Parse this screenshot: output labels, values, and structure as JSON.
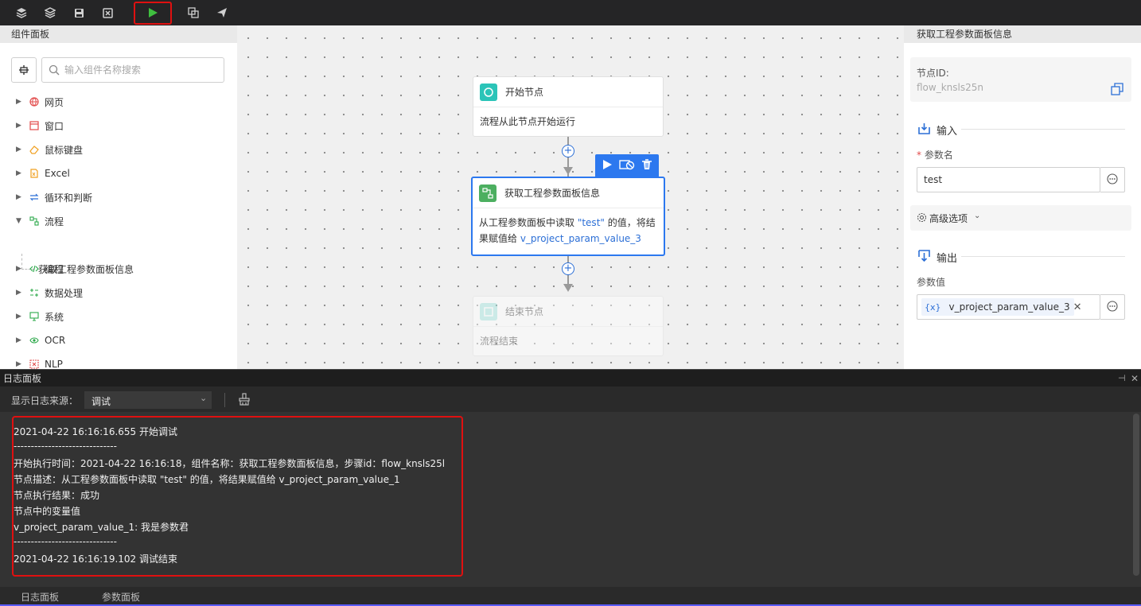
{
  "toolbar": {
    "icons": [
      "layers-icon",
      "layers-alt-icon",
      "save-icon",
      "close-icon",
      "play-icon",
      "copy-icon",
      "send-icon"
    ],
    "run_highlight_color": "#e01010"
  },
  "left_panel": {
    "title": "组件面板",
    "search_placeholder": "输入组件名称搜索",
    "tree": [
      {
        "label": "网页",
        "icon": "globe-icon",
        "color": "#e24a4a"
      },
      {
        "label": "窗口",
        "icon": "window-icon",
        "color": "#e24a4a"
      },
      {
        "label": "鼠标键盘",
        "icon": "eraser-icon",
        "color": "#f0a020"
      },
      {
        "label": "Excel",
        "icon": "excel-icon",
        "color": "#f0a020"
      },
      {
        "label": "循环和判断",
        "icon": "loop-icon",
        "color": "#2c6fd6"
      },
      {
        "label": "流程",
        "icon": "flow-icon",
        "color": "#2ca84a",
        "expanded": true
      },
      {
        "label": "编程",
        "icon": "code-icon",
        "color": "#2ca84a"
      },
      {
        "label": "数据处理",
        "icon": "data-icon",
        "color": "#2ca84a"
      },
      {
        "label": "系统",
        "icon": "monitor-icon",
        "color": "#2ca84a"
      },
      {
        "label": "OCR",
        "icon": "eye-icon",
        "color": "#2ca84a"
      },
      {
        "label": "NLP",
        "icon": "nlp-icon",
        "color": "#e24a4a"
      }
    ],
    "flow_child": "获取工程参数面板信息"
  },
  "canvas": {
    "start_node": {
      "title": "开始节点",
      "body": "流程从此节点开始运行"
    },
    "main_node": {
      "title": "获取工程参数面板信息",
      "body_prefix": "从工程参数面板中读取 ",
      "body_param": "\"test\"",
      "body_mid": " 的值，将结",
      "body_line2_prefix": "果赋值给 ",
      "body_var": "v_project_param_value_3"
    },
    "end_node": {
      "title": "结束节点",
      "body": "流程结束"
    }
  },
  "right_panel": {
    "title": "获取工程参数面板信息",
    "node_id_label": "节点ID:",
    "node_id_value": "flow_knsls25n",
    "input_section": "输入",
    "param_name_label": "参数名",
    "required_mark": "*",
    "param_name_value": "test",
    "advanced_label": "高级选项",
    "output_section": "输出",
    "param_value_label": "参数值",
    "var_token": "{x}",
    "output_var": "v_project_param_value_3"
  },
  "log_panel": {
    "title": "日志面板",
    "source_label": "显示日志来源：",
    "source_value": "调试",
    "lines": [
      "2021-04-22 16:16:16.655 开始调试",
      "------------------------------",
      "开始执行时间：2021-04-22 16:16:18，组件名称：获取工程参数面板信息，步骤id：flow_knsls25l",
      "节点描述：从工程参数面板中读取 \"test\" 的值，将结果赋值给 v_project_param_value_1",
      "节点执行结果：成功",
      "节点中的变量值",
      "v_project_param_value_1: 我是参数君",
      "------------------------------",
      "2021-04-22 16:16:19.102 调试结束"
    ]
  },
  "status_bar": {
    "tabs": [
      "日志面板",
      "参数面板"
    ]
  }
}
